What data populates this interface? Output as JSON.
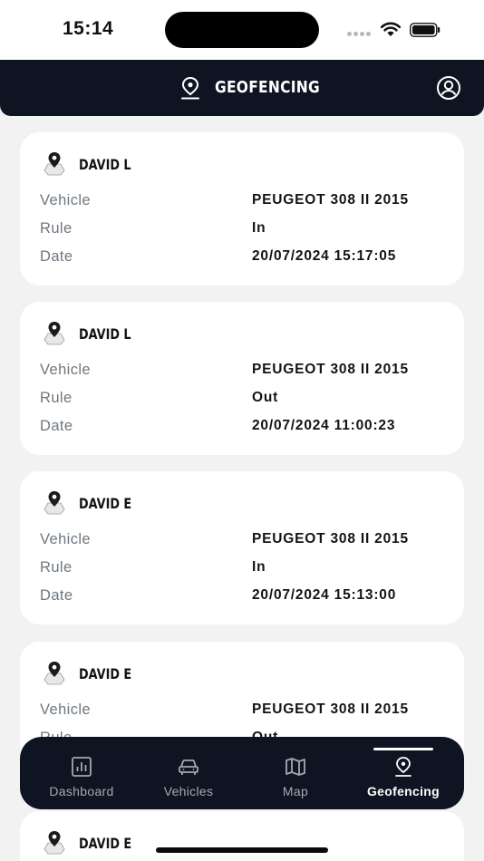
{
  "status_bar": {
    "time": "15:14"
  },
  "header": {
    "title": "GEOFENCING"
  },
  "labels": {
    "vehicle": "Vehicle",
    "rule": "Rule",
    "date": "Date"
  },
  "events": [
    {
      "name": "DAVID L",
      "vehicle": "PEUGEOT 308 II 2015",
      "rule": "In",
      "date": "20/07/2024 15:17:05"
    },
    {
      "name": "DAVID L",
      "vehicle": "PEUGEOT 308 II 2015",
      "rule": "Out",
      "date": "20/07/2024 11:00:23"
    },
    {
      "name": "DAVID E",
      "vehicle": "PEUGEOT 308 II 2015",
      "rule": "In",
      "date": "20/07/2024 15:13:00"
    },
    {
      "name": "DAVID E",
      "vehicle": "PEUGEOT 308 II 2015",
      "rule": "Out",
      "date": ""
    },
    {
      "name": "DAVID E",
      "vehicle": "",
      "rule": "",
      "date": ""
    }
  ],
  "tabs": [
    {
      "label": "Dashboard",
      "icon": "chart-icon"
    },
    {
      "label": "Vehicles",
      "icon": "car-icon"
    },
    {
      "label": "Map",
      "icon": "map-icon"
    },
    {
      "label": "Geofencing",
      "icon": "geofence-pin-icon"
    }
  ],
  "colors": {
    "header_bg": "#0f1422",
    "page_bg": "#f2f2f2",
    "card_bg": "#ffffff",
    "label_gray": "#6f7780"
  }
}
